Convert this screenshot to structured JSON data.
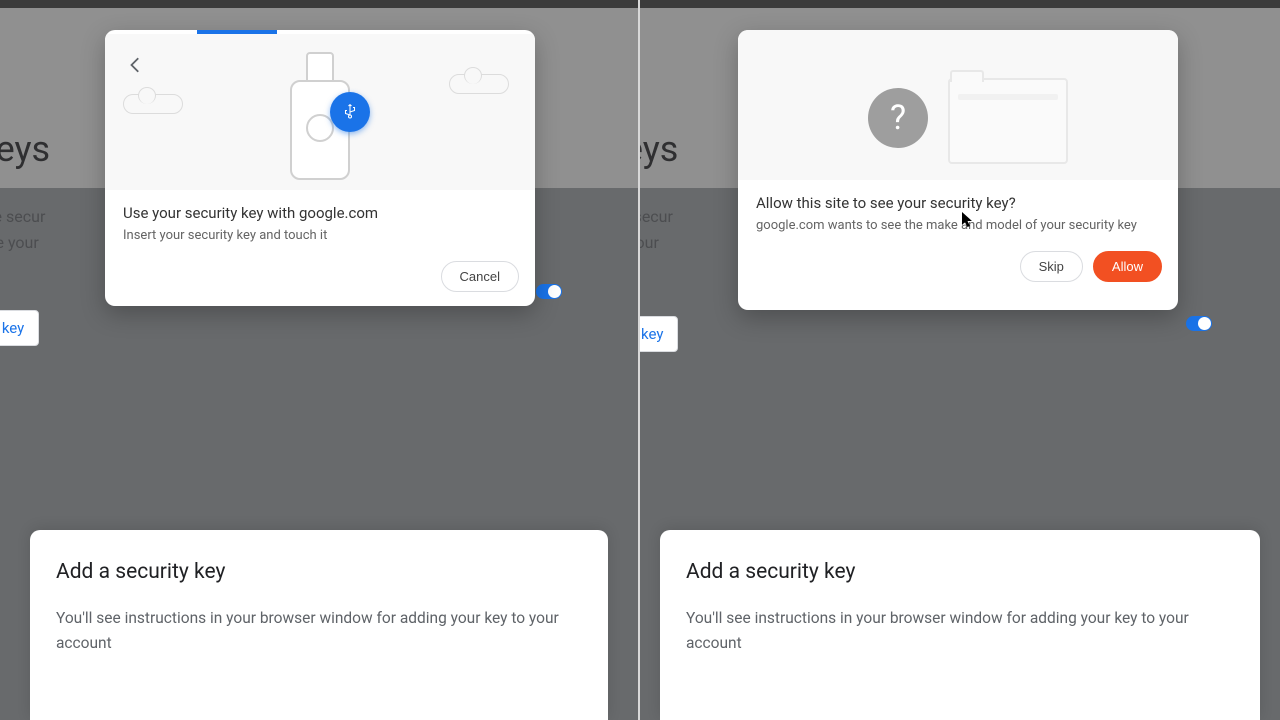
{
  "background": {
    "heading_partial_left": "ty keys",
    "heading_partial_right": "y keys",
    "desc_line1_left": "e a more secur",
    "desc_line2_left": "ey or use your",
    "desc_line1_right": "a more secur",
    "desc_line2_right": "or use your",
    "link_left": "y key",
    "link_right": "key"
  },
  "modal_left": {
    "title": "Use your security key with google.com",
    "subtitle": "Insert your security key and touch it",
    "cancel": "Cancel"
  },
  "modal_right": {
    "title": "Allow this site to see your security key?",
    "subtitle": "google.com wants to see the make and model of your security key",
    "skip": "Skip",
    "allow": "Allow",
    "qmark": "?"
  },
  "card": {
    "title": "Add a security key",
    "desc": "You'll see instructions in your browser window for adding your key to your account"
  }
}
